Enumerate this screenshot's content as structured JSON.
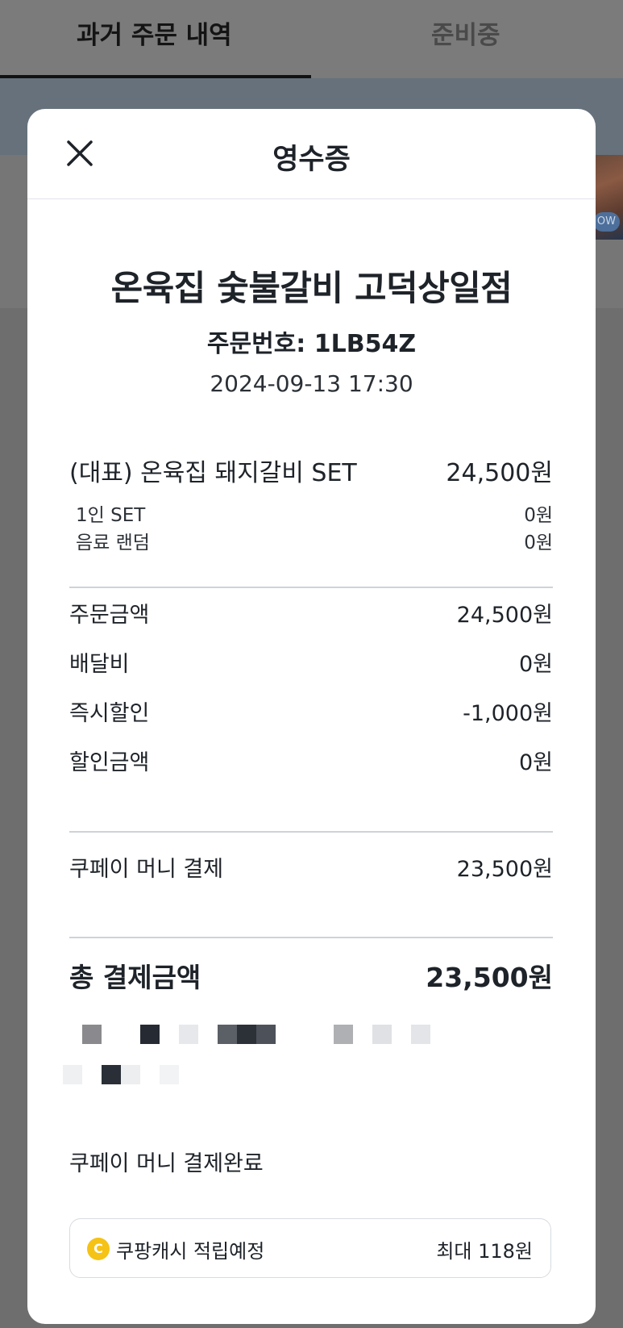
{
  "background": {
    "tabs": [
      "과거 주문 내역",
      "준비중"
    ],
    "thumbnail_badge": "OW"
  },
  "receipt": {
    "title": "영수증",
    "store_name": "온육집 숯불갈비 고덕상일점",
    "order_number": "주문번호: 1LB54Z",
    "order_datetime": "2024-09-13 17:30",
    "item": {
      "name": "(대표) 온육집 돼지갈비 SET",
      "price": "24,500원",
      "options": [
        {
          "name": "1인 SET",
          "price": "0원"
        },
        {
          "name": "음료 랜덤",
          "price": "0원"
        }
      ]
    },
    "summary": [
      {
        "label": "주문금액",
        "value": "24,500원"
      },
      {
        "label": "배달비",
        "value": "0원"
      },
      {
        "label": "즉시할인",
        "value": "-1,000원"
      },
      {
        "label": "할인금액",
        "value": "0원"
      }
    ],
    "payment": {
      "label": "쿠페이 머니 결제",
      "value": "23,500원"
    },
    "total": {
      "label": "총 결제금액",
      "value": "23,500원"
    },
    "payment_status": "쿠페이 머니  결제완료",
    "cashback": {
      "coin_symbol": "C",
      "label": "쿠팡캐시 적립예정",
      "value": "최대 118원"
    }
  },
  "colors": {
    "overlay": "#6e6e6e",
    "text": "#1e2329",
    "divider": "#cfd3d8",
    "coin": "#f5c216"
  },
  "icons": {
    "close": "close-icon",
    "coin": "coupang-cash-coin-icon"
  }
}
